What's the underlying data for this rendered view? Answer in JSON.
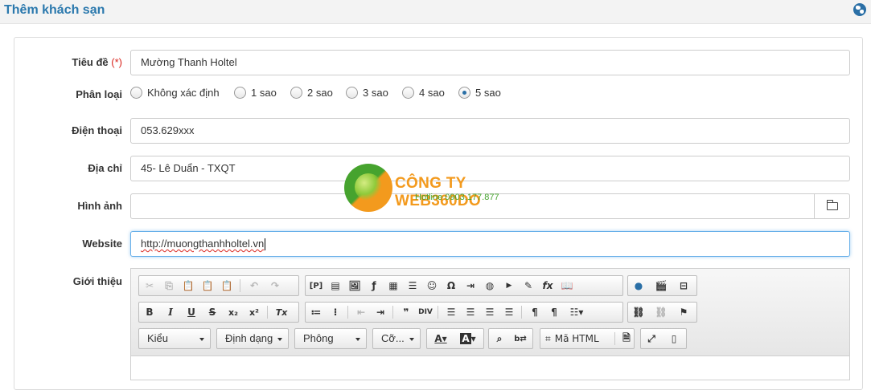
{
  "header": {
    "title": "Thêm khách sạn"
  },
  "form": {
    "title_label": "Tiêu đề",
    "required_mark": "(*)",
    "title_value": "Mường Thanh Holtel",
    "category_label": "Phân loại",
    "category_options": [
      "Không xác định",
      "1 sao",
      "2 sao",
      "3 sao",
      "4 sao",
      "5 sao"
    ],
    "category_selected": "5 sao",
    "phone_label": "Điện thoại",
    "phone_value": "053.629xxx",
    "address_label": "Địa chỉ",
    "address_value": "45- Lê Duẩn - TXQT",
    "image_label": "Hình ảnh",
    "image_value": "",
    "website_label": "Website",
    "website_value": "http://muongthanhholtel.vn",
    "intro_label": "Giới thiệu"
  },
  "watermark": {
    "company": "CÔNG TY WEB360DO",
    "hotline": "Hotline 0903.177.877"
  },
  "editor": {
    "combos": {
      "style": "Kiểu",
      "format": "Định dạng",
      "font": "Phông",
      "size": "Cỡ..."
    },
    "html_button": "Mã HTML",
    "glyphs": {
      "bold": "B",
      "italic": "I",
      "underline": "U",
      "strike": "S",
      "subscript": "x₂",
      "superscript": "x²",
      "remove_format": "Tx",
      "font_color": "A",
      "bg_color": "A",
      "omega": "Ω",
      "fx": "fx",
      "quote": "❞",
      "template": "[P]",
      "zoom": "🔍"
    }
  },
  "colors": {
    "title": "#2a78ad",
    "required": "#d9241d",
    "logo_orange": "#f39a1d",
    "logo_green": "#46a32e",
    "focus_border": "#66afe9"
  }
}
